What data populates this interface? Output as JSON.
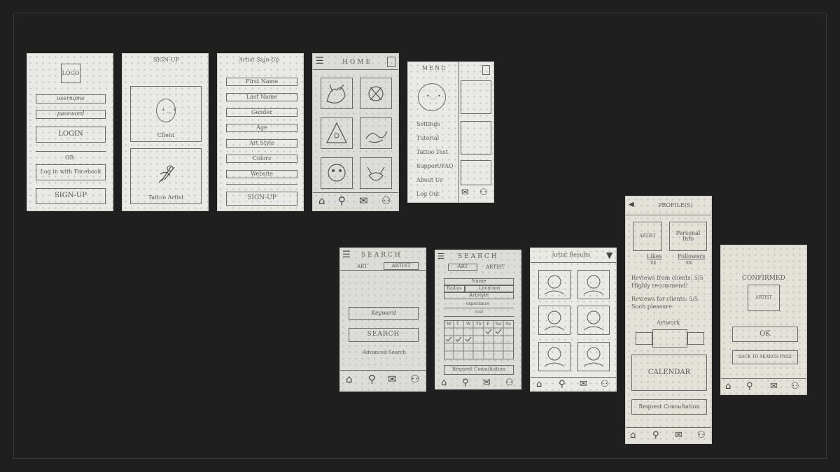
{
  "screens": {
    "login": {
      "logo": "LOGO",
      "username_placeholder": "username",
      "password_placeholder": "password",
      "login_label": "LOGIN",
      "or_label": "OR",
      "facebook_label": "Log in with Facebook",
      "signup_label": "SIGN-UP"
    },
    "signup": {
      "title": "SIGN-UP",
      "client_label": "Client",
      "artist_label": "Tattoo Artist"
    },
    "artist_signup": {
      "title": "Artist Sign-Up",
      "fields": [
        "First Name",
        "Last Name",
        "Gender",
        "Age",
        "Art Style",
        "Colors",
        "Website"
      ],
      "submit_label": "SIGN-UP"
    },
    "home": {
      "title": "HOME"
    },
    "menu": {
      "title": "MENU",
      "items": [
        "Settings",
        "Tutorial",
        "Tattoo Test",
        "Support/FAQ",
        "About Us",
        "Log Out"
      ]
    },
    "search_a": {
      "title": "SEARCH",
      "tabs": [
        "ART",
        "ARTIST"
      ],
      "keyword_placeholder": "Keyword",
      "search_label": "SEARCH",
      "advanced_label": "Advanced Search"
    },
    "search_b": {
      "title": "SEARCH",
      "tabs": [
        "ART",
        "ARTIST"
      ],
      "name_label": "Name",
      "radius_label": "Radius",
      "location_label": "Location",
      "artstyle_label": "Artstyle",
      "experience_label": "experience",
      "cost_label": "cost",
      "days": [
        "M",
        "T",
        "W",
        "Th",
        "F",
        "Sa",
        "Su"
      ],
      "request_label": "Request Consultation"
    },
    "results": {
      "title": "Artist Results"
    },
    "profile": {
      "title": "PROFILE(S)",
      "avatar_label": "ARTIST",
      "personal_info": "Personal Info",
      "likes_label": "Likes",
      "followers_label": "Followers",
      "likes_count": "XX",
      "followers_count": "XX",
      "review_1": "Reviews from clients: 5/5 Highly recommend!",
      "review_2": "Reviews for clients: 5/5 Such pleasure",
      "artwork_label": "Artwork",
      "calendar_label": "CALENDAR",
      "request_label": "Request Consultation"
    },
    "confirmed": {
      "title": "CONFIRMED",
      "artist_label": "ARTIST",
      "ok_label": "OK",
      "back_label": "BACK TO SEARCH PAGE"
    }
  },
  "icons": [
    "menu-icon",
    "notebook-icon",
    "home-icon",
    "search-icon",
    "mail-icon",
    "profile-icon",
    "filter-icon",
    "back-arrow-icon",
    "heart-icon"
  ],
  "colors": {
    "background": "#1f1f20",
    "paper": "#e9e9e6",
    "pencil": "#5a5a5a"
  }
}
